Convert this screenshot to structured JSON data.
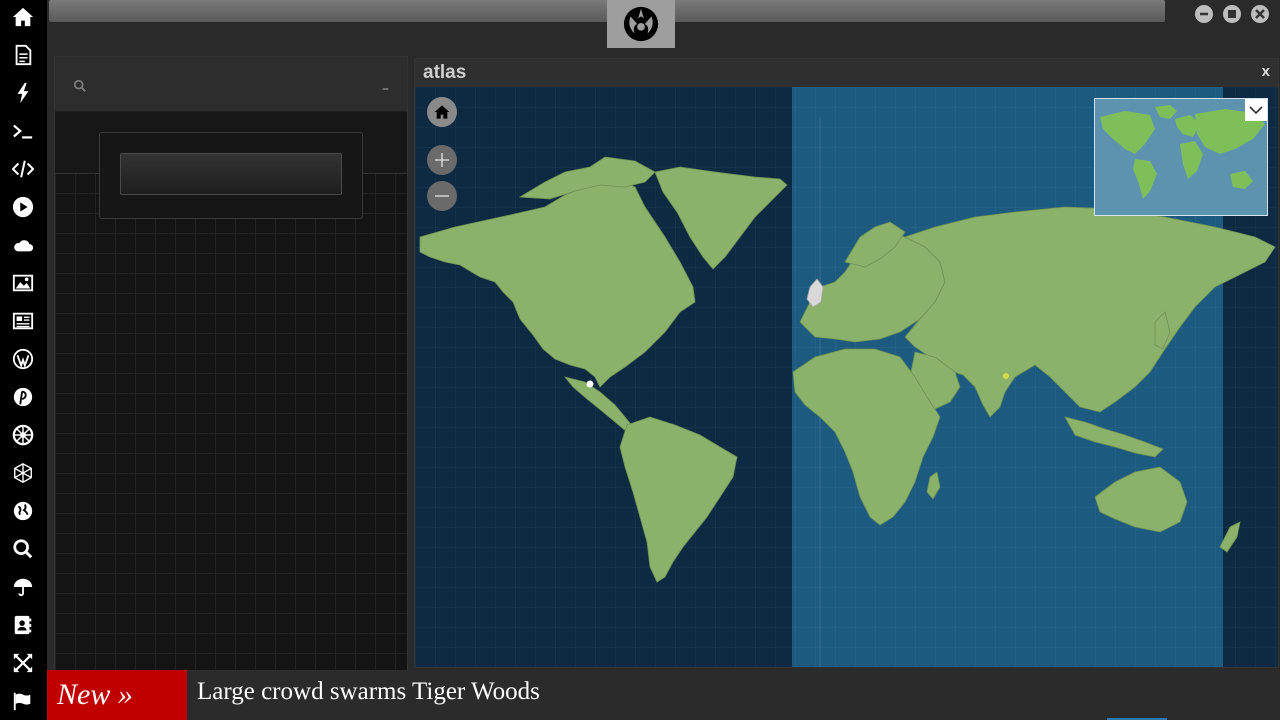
{
  "sidebar": {
    "items": [
      {
        "icon": "home-icon"
      },
      {
        "icon": "document-icon"
      },
      {
        "icon": "lightning-icon"
      },
      {
        "icon": "terminal-icon"
      },
      {
        "icon": "code-icon"
      },
      {
        "icon": "play-icon"
      },
      {
        "icon": "cloud-icon"
      },
      {
        "icon": "image-icon"
      },
      {
        "icon": "newspaper-icon"
      },
      {
        "icon": "wordpress-icon"
      },
      {
        "icon": "pinterest-icon"
      },
      {
        "icon": "empire-icon"
      },
      {
        "icon": "network-icon"
      },
      {
        "icon": "globe-icon"
      },
      {
        "icon": "search-icon"
      },
      {
        "icon": "umbrella-icon"
      },
      {
        "icon": "contacts-icon"
      },
      {
        "icon": "expand-icon"
      },
      {
        "icon": "flag-icon"
      }
    ]
  },
  "header": {
    "logo_icon": "rebel-alliance-icon"
  },
  "atlas": {
    "title": "atlas",
    "close_label": "x"
  },
  "left_panel": {
    "minimize_label": "–"
  },
  "ticker": {
    "badge": "New »",
    "headline": "Large crowd swarms Tiger Woods"
  },
  "colors": {
    "sidebar_bg": "#000000",
    "ocean_night": "#0e2a42",
    "ocean_day": "#1d5a80",
    "land": "#8bb26b",
    "ticker_badge": "#c00000"
  }
}
